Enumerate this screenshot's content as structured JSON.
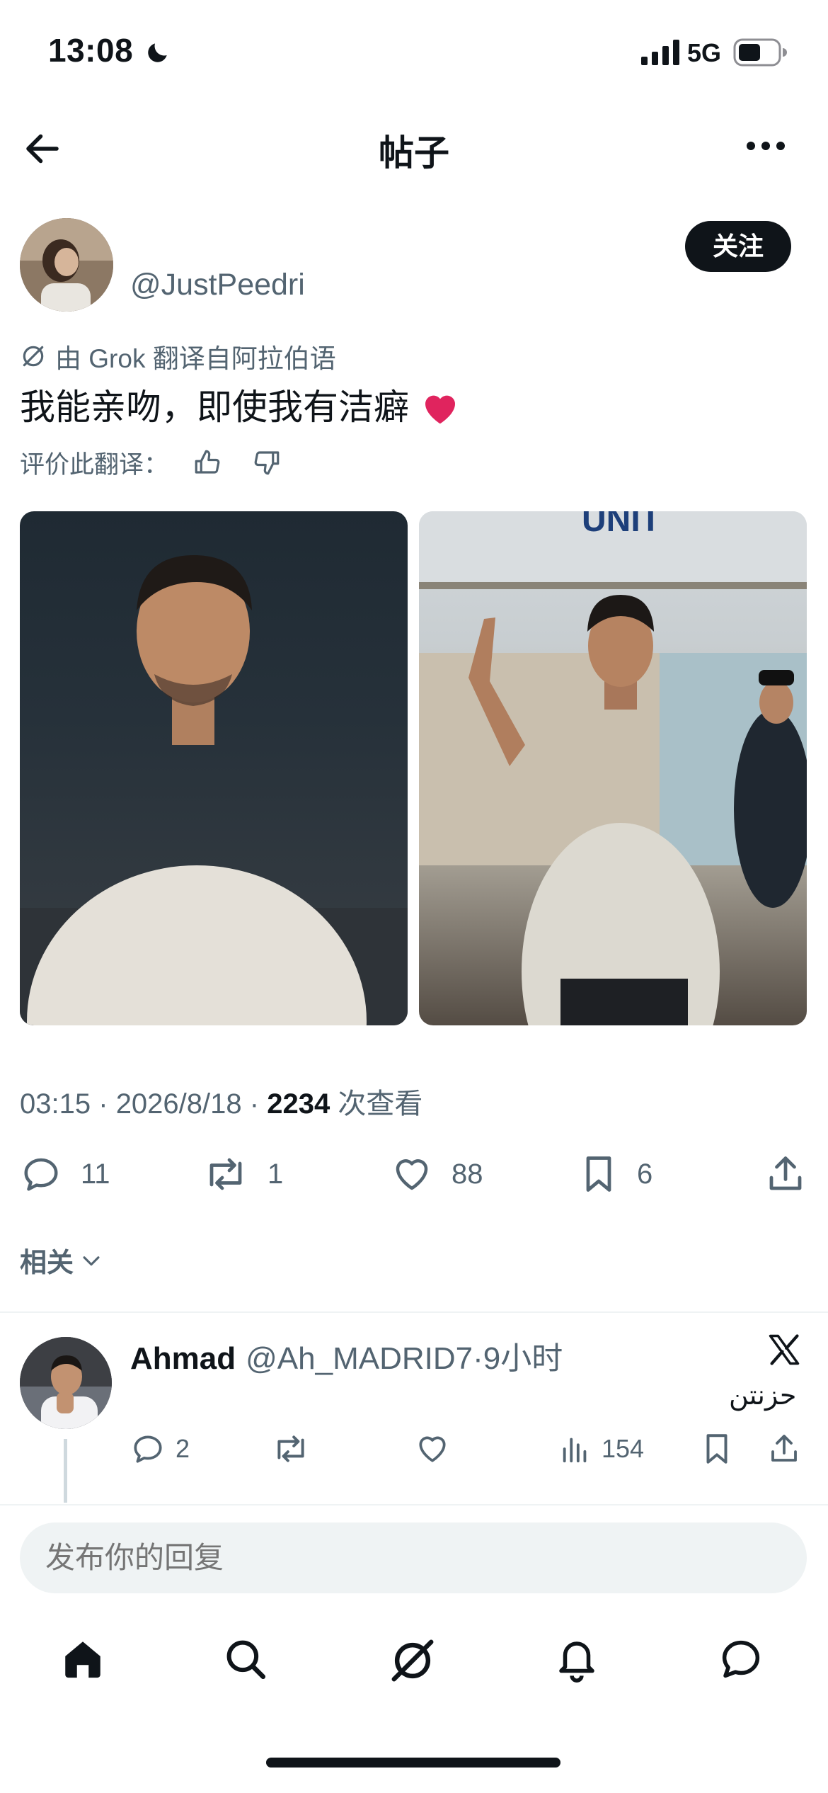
{
  "status_bar": {
    "time": "13:08",
    "network": "5G"
  },
  "nav": {
    "title": "帖子"
  },
  "author": {
    "handle": "@JustPeedri",
    "follow_label": "关注"
  },
  "translation": {
    "source_note": "由 Grok 翻译自阿拉伯语",
    "post_text": "我能亲吻，即使我有洁癖",
    "emoji": "❤️",
    "rate_label": "评价此翻译："
  },
  "meta": {
    "time": "03:15",
    "date": "2026/8/18",
    "views": "2234",
    "views_label": "次查看",
    "sep": "·"
  },
  "actions": {
    "replies": "11",
    "reposts": "1",
    "likes": "88",
    "bookmarks": "6"
  },
  "related_label": "相关",
  "reply": {
    "name": "Ahmad",
    "handle": "@Ah_MADRID7",
    "time": "·9小时",
    "text": "حزنتن",
    "replies": "2",
    "views": "154"
  },
  "composer": {
    "placeholder": "发布你的回复"
  },
  "colors": {
    "accent": "#0f1419",
    "muted": "#536471",
    "heart": "#e0245e"
  }
}
